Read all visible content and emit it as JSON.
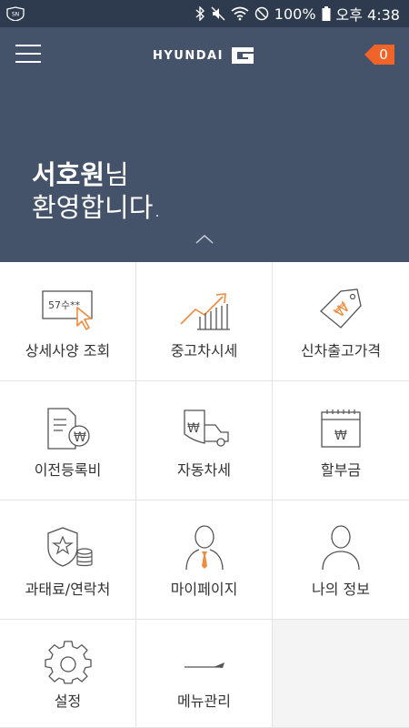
{
  "status_bar": {
    "sn_badge": "SN",
    "battery": "100%",
    "time": "오후 4:38"
  },
  "header": {
    "brand": "HYUNDAI",
    "brand_mark": "G",
    "notification_count": "0",
    "user_name": "서호원",
    "greeting_suffix": "님",
    "welcome_line": "환영합니다."
  },
  "menu": {
    "items": [
      {
        "label": "상세사양 조회",
        "icon": "spec-card-icon",
        "card_text": "57수**"
      },
      {
        "label": "중고차시세",
        "icon": "rising-chart-icon"
      },
      {
        "label": "신차출고가격",
        "icon": "price-tag-icon"
      },
      {
        "label": "이전등록비",
        "icon": "document-won-icon"
      },
      {
        "label": "자동차세",
        "icon": "car-won-icon"
      },
      {
        "label": "할부금",
        "icon": "calendar-won-icon"
      },
      {
        "label": "과태료/연락처",
        "icon": "badge-coins-icon"
      },
      {
        "label": "마이페이지",
        "icon": "person-tie-icon"
      },
      {
        "label": "나의 정보",
        "icon": "person-icon"
      },
      {
        "label": "설정",
        "icon": "gear-icon"
      },
      {
        "label": "메뉴관리",
        "icon": "flag-arrow-icon"
      }
    ]
  },
  "colors": {
    "header_bg": "#44536a",
    "status_bg": "#2e3b4e",
    "accent_orange": "#f0642a",
    "icon_orange": "#f08a3c",
    "empty_cell": "#f4f4f4"
  }
}
